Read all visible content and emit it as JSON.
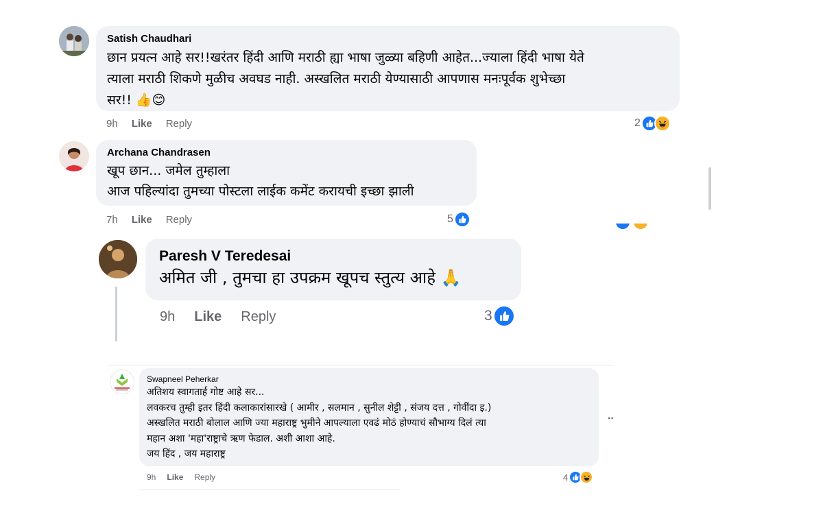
{
  "comments": [
    {
      "author": "Satish Chaudhari",
      "text": "छान प्रयत्न आहे सर!!खरंतर हिंदी आणि मराठी ह्या भाषा जुळ्या बहिणी आहेत...ज्याला हिंदी भाषा येते\nत्याला मराठी शिकणे मुळीच अवघड नाही. अस्खलित मराठी येण्यासाठी आपणास मनःपूर्वक शुभेच्छा\nसर!! 👍😊",
      "time": "9h",
      "like": "Like",
      "reply": "Reply",
      "reaction_count": "2"
    },
    {
      "author": "Archana Chandrasen",
      "text": "खूप छान... जमेल तुम्हाला\nआज पहिल्यांदा तुमच्या पोस्टला लाईक कमेंट करायची इच्छा झाली",
      "time": "7h",
      "like": "Like",
      "reply": "Reply",
      "reaction_count": "5"
    },
    {
      "author": "Paresh V Teredesai",
      "text": "अमित जी , तुमचा हा उपक्रम खूपच स्तुत्य आहे 🙏",
      "time": "9h",
      "like": "Like",
      "reply": "Reply",
      "reaction_count": "3"
    },
    {
      "author": "Swapneel Peherkar",
      "text": "अतिशय स्वागतार्ह गोष्ट आहे सर...\nलवकरच तुम्ही इतर हिंदी कलाकारांसारखे ( आमीर , सलमान , सुनील शेट्टी , संजय दत्त , गोवींदा इ.)\nअस्खलित मराठी बोलाल आणि ज्या महाराष्ट्र भुमीने आपल्याला एवढं मोठं होण्याचं सौभाग्य दिलं त्या\nमहान अशा 'महा'राष्ट्राचे ऋण फेडाल. अशी आशा आहे.\nजय हिंद , जय महाराष्ट्र",
      "time": "9h",
      "like": "Like",
      "reply": "Reply",
      "reaction_count": "4",
      "more": ".."
    }
  ],
  "colors": {
    "bubble": "#f0f2f5",
    "like_blue": "#1877f2",
    "meta_gray": "#65676b",
    "haha_yellow": "#f7b125"
  },
  "icons": [
    "like-reaction-icon",
    "haha-reaction-icon",
    "more-options-icon"
  ]
}
